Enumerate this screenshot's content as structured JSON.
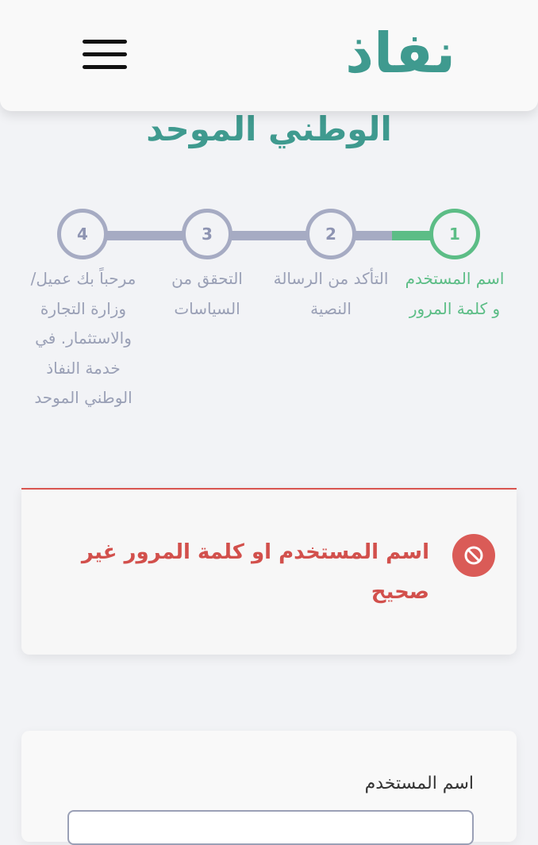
{
  "header": {
    "logo_text": "نفاذ",
    "menu_icon": "hamburger-icon"
  },
  "page": {
    "title": "الوطني الموحد"
  },
  "stepper": {
    "steps": [
      {
        "number": "1",
        "label": "اسم المستخدم و كلمة المرور",
        "state": "active"
      },
      {
        "number": "2",
        "label": "التأكد من الرسالة النصية",
        "state": "pending"
      },
      {
        "number": "3",
        "label": "التحقق من السياسات",
        "state": "pending"
      },
      {
        "number": "4",
        "label": "مرحباً بك عميل/ وزارة التجارة والاستثمار. في خدمة النفاذ الوطني الموحد",
        "state": "pending"
      }
    ]
  },
  "error": {
    "message": "اسم المستخدم او كلمة المرور غير صحيح",
    "icon": "block-icon"
  },
  "form": {
    "username_label": "اسم المستخدم",
    "username_value": ""
  },
  "colors": {
    "brand": "#3f9a8f",
    "success": "#5cbd86",
    "error": "#d9534f",
    "inactive": "#a6abc3"
  }
}
